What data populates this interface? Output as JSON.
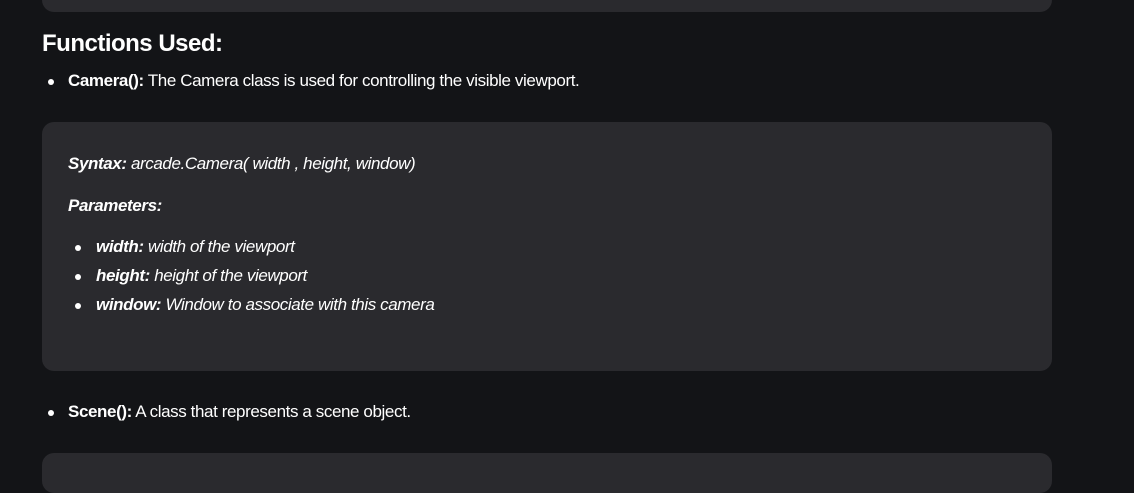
{
  "heading": "Functions Used:",
  "functions": [
    {
      "name": "Camera():",
      "description": "The Camera class is used for controlling the visible viewport."
    },
    {
      "name": "Scene():",
      "description": "A class that represents a scene object."
    }
  ],
  "camera_box": {
    "syntax_label": "Syntax:",
    "syntax_value": "arcade.Camera( width , height, window)",
    "parameters_label": "Parameters:",
    "params": [
      {
        "name": "width:",
        "desc": "width of the viewport"
      },
      {
        "name": "height:",
        "desc": "height of the viewport"
      },
      {
        "name": "window:",
        "desc": "Window to associate with this camera"
      }
    ]
  }
}
